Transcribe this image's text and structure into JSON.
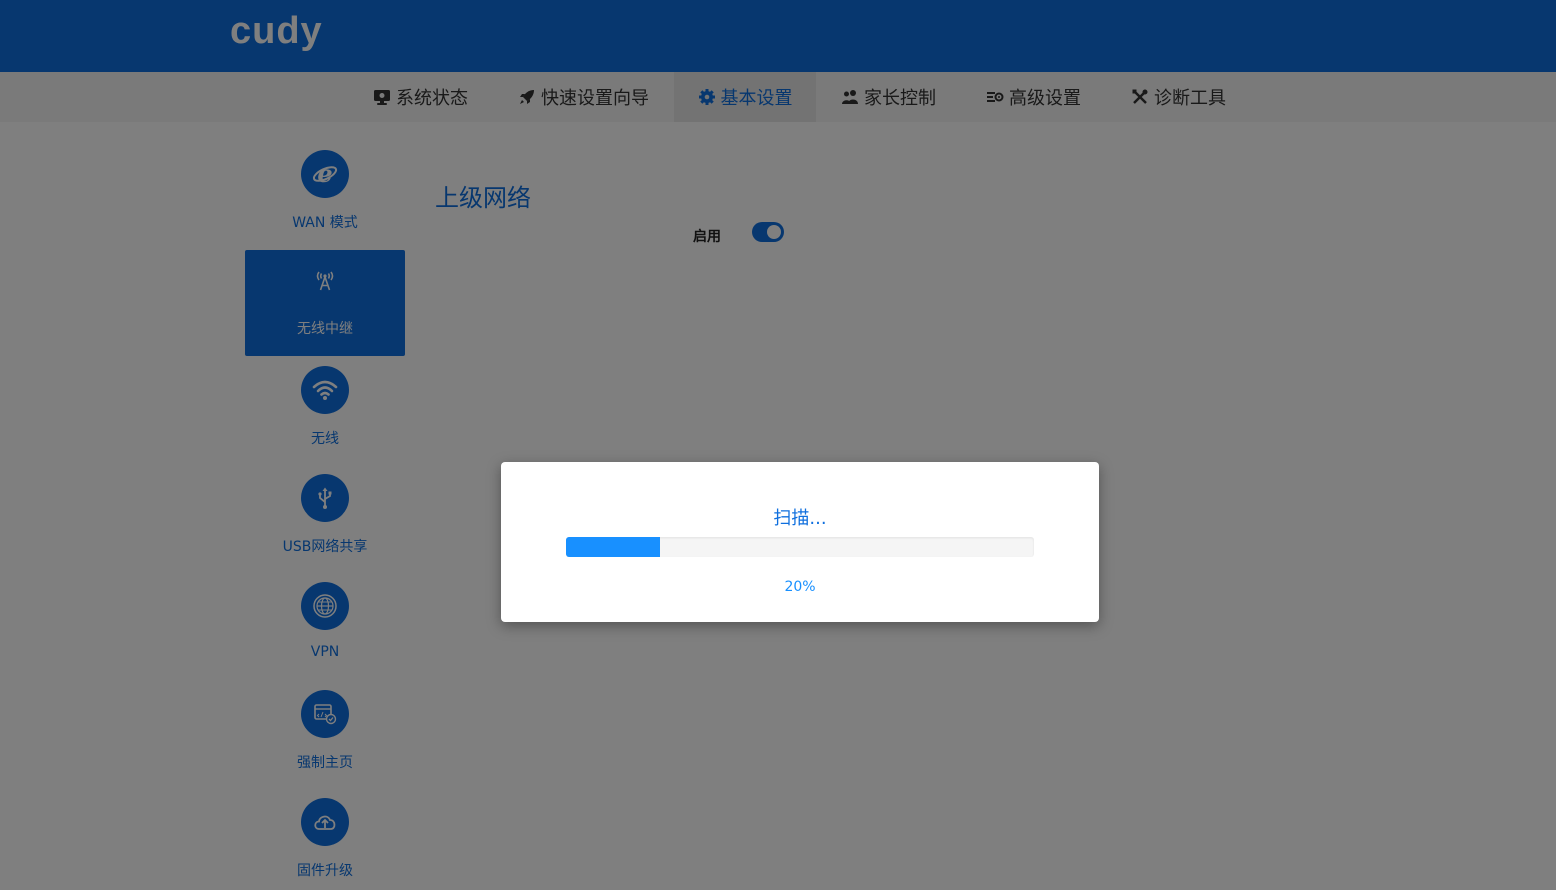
{
  "header": {
    "logo": "cudy"
  },
  "nav": {
    "items": [
      {
        "label": "系统状态",
        "icon": "monitor-icon"
      },
      {
        "label": "快速设置向导",
        "icon": "rocket-icon"
      },
      {
        "label": "基本设置",
        "icon": "gear-icon",
        "active": true
      },
      {
        "label": "家长控制",
        "icon": "users-icon"
      },
      {
        "label": "高级设置",
        "icon": "advanced-settings-icon"
      },
      {
        "label": "诊断工具",
        "icon": "wrench-icon"
      }
    ]
  },
  "sidebar": {
    "items": [
      {
        "label": "WAN 模式",
        "icon": "internet-explorer-icon"
      },
      {
        "label": "无线中继",
        "icon": "antenna-icon",
        "active": true
      },
      {
        "label": "无线",
        "icon": "wifi-icon"
      },
      {
        "label": "USB网络共享",
        "icon": "usb-icon"
      },
      {
        "label": "VPN",
        "icon": "globe-icon"
      },
      {
        "label": "强制主页",
        "icon": "portal-page-icon"
      },
      {
        "label": "固件升级",
        "icon": "cloud-upload-icon"
      }
    ]
  },
  "main": {
    "title": "上级网络",
    "enable_label": "启用",
    "enabled": true
  },
  "modal": {
    "title": "扫描...",
    "progress": 0.2,
    "progress_text": "20%"
  },
  "colors": {
    "brand": "#0f6fde",
    "progress": "#1890ff"
  }
}
